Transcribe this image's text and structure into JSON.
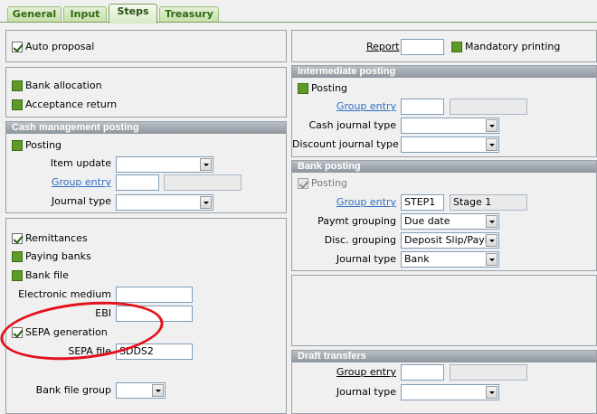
{
  "tabs": [
    "General",
    "Input",
    "Steps",
    "Treasury"
  ],
  "left": {
    "auto_proposal": "Auto proposal",
    "bank_allocation": "Bank allocation",
    "acceptance_return": "Acceptance return",
    "cash_mgmt": {
      "header": "Cash management posting",
      "posting": "Posting",
      "item_update": "Item update",
      "group_entry": "Group entry",
      "journal_type": "Journal type"
    },
    "remittances": "Remittances",
    "paying_banks": "Paying banks",
    "bank_file": "Bank file",
    "electronic_medium": "Electronic medium",
    "ebi": "EBI",
    "sepa_generation": "SEPA generation",
    "sepa_file": "SEPA file",
    "sepa_file_value": "SDDS2",
    "bank_file_group": "Bank file group"
  },
  "right": {
    "report": "Report",
    "mandatory_printing": "Mandatory printing",
    "intermediate": {
      "header": "Intermediate posting",
      "posting": "Posting",
      "group_entry": "Group entry",
      "cash_journal_type": "Cash journal type",
      "discount_journal_type": "Discount journal type"
    },
    "bank_posting": {
      "header": "Bank posting",
      "posting": "Posting",
      "group_entry": "Group entry",
      "group_entry_code": "STEP1",
      "group_entry_desc": "Stage 1",
      "paymt_grouping": "Paymt grouping",
      "paymt_grouping_value": "Due date",
      "disc_grouping": "Disc. grouping",
      "disc_grouping_value": "Deposit Slip/Payin",
      "journal_type": "Journal type",
      "journal_type_value": "Bank"
    },
    "draft_transfers": {
      "header": "Draft transfers",
      "group_entry": "Group entry",
      "journal_type": "Journal type"
    }
  }
}
